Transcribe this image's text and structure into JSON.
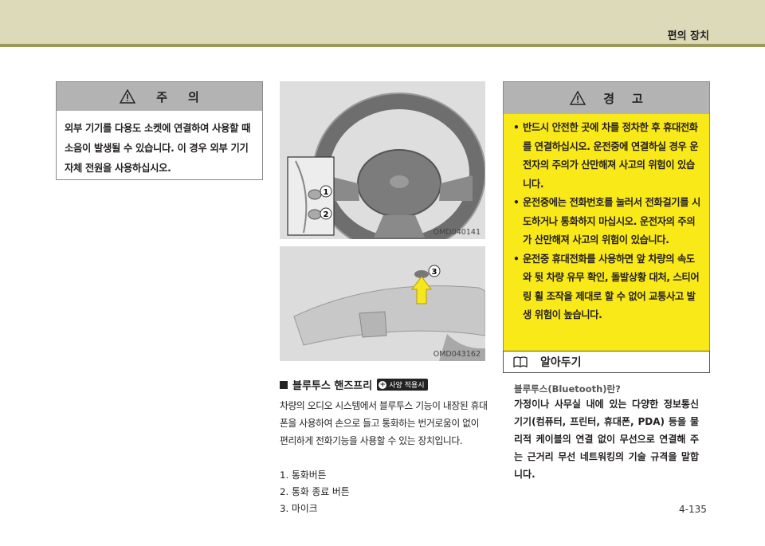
{
  "header": {
    "title": "편의 장치"
  },
  "caution": {
    "title_a": "주",
    "title_b": "의",
    "body": "외부 기기를 다용도 소켓에 연결하여 사용할 때 소음이 발생될 수 있습니다. 이 경우 외부 기기 자체 전원을 사용하십시오."
  },
  "figure1": {
    "code": "OMD040141",
    "callout1": "1",
    "callout2": "2"
  },
  "figure2": {
    "code": "OMD043162",
    "callout3": "3"
  },
  "section": {
    "title": "블루투스 핸즈프리",
    "badge": "사양 적용시",
    "paragraph": "차량의 오디오 시스템에서 블루투스 기능이 내장된 휴대폰을 사용하여 손으로 들고 통화하는 번거로움이 없이 편리하게 전화기능을 사용할 수 있는 장치입니다.",
    "items": [
      "1.  통화버튼",
      "2.  통화 종료 버튼",
      "3.  마이크"
    ]
  },
  "warning": {
    "title_a": "경",
    "title_b": "고",
    "items": [
      "반드시 안전한 곳에 차를 정차한 후 휴대전화를 연결하십시오. 운전중에 연결하실 경우 운전자의 주의가 산만해져 사고의 위험이 있습니다.",
      "운전중에는 전화번호를 눌러서 전화걸기를 시도하거나 통화하지 마십시오. 운전자의 주의가 산만해져 사고의 위험이 있습니다.",
      "운전중 휴대전화를 사용하면 앞 차량의 속도와 뒷 차량 유무 확인, 돌발상황 대처, 스티어링 휠 조작을 제대로 할 수 없어 교통사고 발생 위험이 높습니다."
    ]
  },
  "note": {
    "title": "알아두기",
    "question": "블루투스(Bluetooth)란?",
    "body": "가정이나 사무실 내에 있는 다양한 정보통신 기기(컴퓨터, 프린터, 휴대폰, PDA) 등을 물리적 케이블의 연결 없이 무선으로 연결해 주는 근거리 무선 네트워킹의 기술 규격을 말합니다."
  },
  "page_number": "4-135"
}
